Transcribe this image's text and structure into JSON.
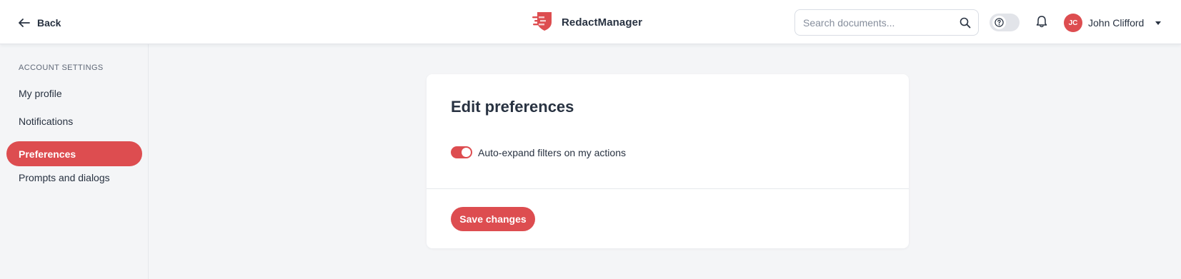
{
  "header": {
    "back_label": "Back",
    "brand_name": "RedactManager",
    "search_placeholder": "Search documents...",
    "user": {
      "initials": "JC",
      "name": "John Clifford"
    }
  },
  "sidebar": {
    "section_title": "ACCOUNT SETTINGS",
    "items": [
      {
        "label": "My profile",
        "active": false
      },
      {
        "label": "Notifications",
        "active": false
      },
      {
        "label": "Preferences",
        "active": true
      },
      {
        "label": "Prompts and dialogs",
        "active": false
      }
    ]
  },
  "main": {
    "title": "Edit preferences",
    "preferences": [
      {
        "label": "Auto-expand filters on my actions",
        "enabled": true
      }
    ],
    "save_label": "Save changes"
  },
  "colors": {
    "accent": "#dd4d50",
    "text": "#283241",
    "background": "#f4f5f7"
  },
  "icons": [
    "arrow-left-icon",
    "logo-icon",
    "search-icon",
    "help-icon",
    "bell-icon",
    "chevron-down-icon"
  ]
}
